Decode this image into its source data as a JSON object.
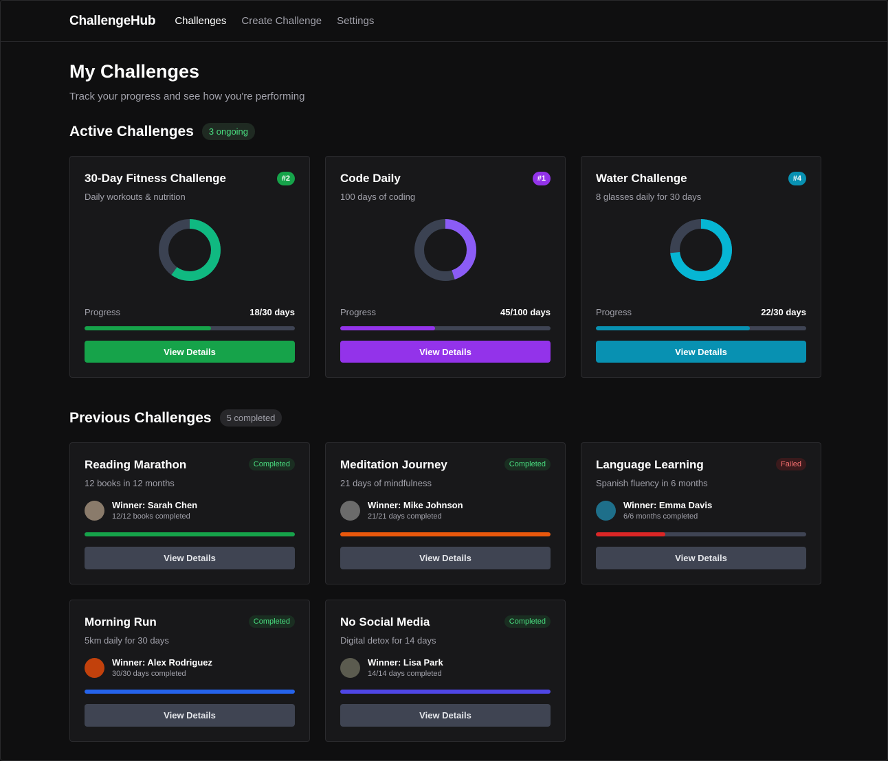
{
  "nav": {
    "brand": "ChallengeHub",
    "links": [
      "Challenges",
      "Create Challenge",
      "Settings"
    ]
  },
  "header": {
    "title": "My Challenges",
    "subtitle": "Track your progress and see how you're performing"
  },
  "active": {
    "title": "Active Challenges",
    "badge": "3 ongoing",
    "cards": [
      {
        "title": "30-Day Fitness Challenge",
        "desc": "Daily workouts & nutrition",
        "rank": "#2",
        "progress_label": "Progress",
        "progress_text": "18/30 days",
        "progress": 0.6,
        "color": "#16a34a",
        "ring_color": "#10b981",
        "button": "View Details"
      },
      {
        "title": "Code Daily",
        "desc": "100 days of coding",
        "rank": "#1",
        "progress_label": "Progress",
        "progress_text": "45/100 days",
        "progress": 0.45,
        "color": "#9333ea",
        "ring_color": "#8b5cf6",
        "button": "View Details"
      },
      {
        "title": "Water Challenge",
        "desc": "8 glasses daily for 30 days",
        "rank": "#4",
        "progress_label": "Progress",
        "progress_text": "22/30 days",
        "progress": 0.733,
        "color": "#0891b2",
        "ring_color": "#06b6d4",
        "button": "View Details"
      }
    ]
  },
  "previous": {
    "title": "Previous Challenges",
    "badge": "5 completed",
    "cards": [
      {
        "title": "Reading Marathon",
        "desc": "12 books in 12 months",
        "status": "Completed",
        "winner": "Winner: Sarah Chen",
        "detail": "12/12 books completed",
        "progress": 1.0,
        "color": "#16a34a",
        "avatar_color": "#8a7b6b",
        "button": "View Details"
      },
      {
        "title": "Meditation Journey",
        "desc": "21 days of mindfulness",
        "status": "Completed",
        "winner": "Winner: Mike Johnson",
        "detail": "21/21 days completed",
        "progress": 1.0,
        "color": "#ea580c",
        "avatar_color": "#6b6b6b",
        "button": "View Details"
      },
      {
        "title": "Language Learning",
        "desc": "Spanish fluency in 6 months",
        "status": "Failed",
        "winner": "Winner: Emma Davis",
        "detail": "6/6 months completed",
        "progress": 0.33,
        "color": "#dc2626",
        "avatar_color": "#1e6f8a",
        "button": "View Details"
      },
      {
        "title": "Morning Run",
        "desc": "5km daily for 30 days",
        "status": "Completed",
        "winner": "Winner: Alex Rodriguez",
        "detail": "30/30 days completed",
        "progress": 1.0,
        "color": "#2563eb",
        "avatar_color": "#c2410c",
        "button": "View Details"
      },
      {
        "title": "No Social Media",
        "desc": "Digital detox for 14 days",
        "status": "Completed",
        "winner": "Winner: Lisa Park",
        "detail": "14/14 days completed",
        "progress": 1.0,
        "color": "#4f46e5",
        "avatar_color": "#5b5b4f",
        "button": "View Details"
      }
    ]
  }
}
